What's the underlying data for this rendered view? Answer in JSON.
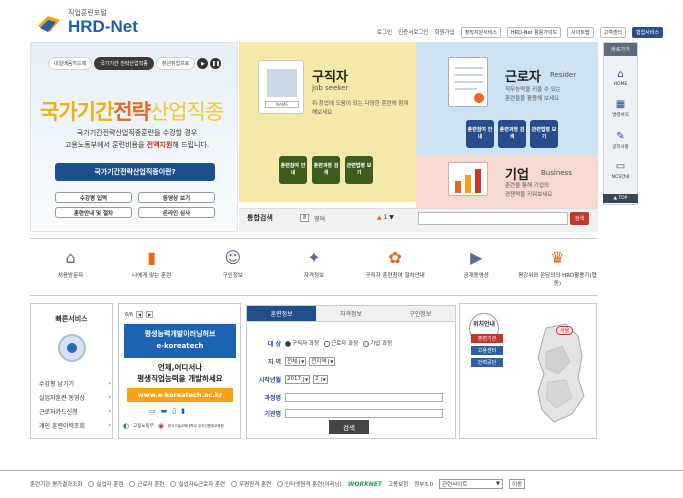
{
  "header": {
    "logo_sub": "직업훈련포털",
    "logo_main": "HRD-Net",
    "util_links": [
      "로그인",
      "인증서로그인",
      "회원가입"
    ],
    "util_buttons": [
      "정직지원서비스",
      "HRD-Net 활용가이드",
      "사이트맵",
      "고객센터"
    ],
    "util_service": "협업서비스"
  },
  "hero": {
    "tabs": [
      "내일배움카드제",
      "국가기간 전략산업직종",
      "청년취업프로"
    ],
    "title_a": "국가기간",
    "title_b": "전략",
    "title_c": "산업직종",
    "desc_line1": "국가기간전략산업직종훈련을 수강할 경우",
    "desc_line2a": "고용노동부에서 훈련비용을 ",
    "desc_line2b": "전액지원",
    "desc_line2c": "해 드립니다.",
    "main_button": "국가기간전략산업직종이란?",
    "buttons": [
      "수강평 입력",
      "동영상 보기",
      "훈련안내 및 절차",
      "온라인 심사"
    ]
  },
  "job_seeker": {
    "title": "구직자",
    "en": "Job seeker",
    "desc": "취·창업에 도움이 되는 다양한 훈련에 참여해보세요",
    "id_name": "NAME",
    "buttons": [
      "훈련참여 안내",
      "훈련과정 검색",
      "관련법령 보기"
    ]
  },
  "worker": {
    "title": "근로자",
    "en": "Resider",
    "desc_1": "직무능력을 키울 수 있는",
    "desc_2": "훈련들을 활용해 보세요",
    "buttons": [
      "훈련참여 안내",
      "훈련과정 검색",
      "관련법령 보기"
    ]
  },
  "business": {
    "title": "기업",
    "en": "Business",
    "desc_1": "훈련을 통해 기업의",
    "desc_2": "경쟁력을 키워보세요"
  },
  "search": {
    "label": "통합검색",
    "badge": "8",
    "lang": "영어",
    "count": "1",
    "go": "검색"
  },
  "sidebar": {
    "head": "바로가기",
    "items": [
      {
        "icon": "⌂",
        "label": "HOME"
      },
      {
        "icon": "▦",
        "label": "발령서식"
      },
      {
        "icon": "✎",
        "label": "공지사항"
      },
      {
        "icon": "▭",
        "label": "NCS안내"
      }
    ],
    "top": "▲ TOP"
  },
  "menu": [
    {
      "icon": "⌂",
      "label": "처음방문자",
      "orange": false
    },
    {
      "icon": "▮",
      "label": "나에게 맞는 훈련",
      "orange": true
    },
    {
      "icon": "☺",
      "label": "구인정보",
      "orange": false
    },
    {
      "icon": "✦",
      "label": "자격정보",
      "orange": false
    },
    {
      "icon": "✿",
      "label": "구직자 훈련참여 절차안내",
      "orange": true
    },
    {
      "icon": "▶",
      "label": "공개동영상",
      "orange": false
    },
    {
      "icon": "♛",
      "label": "평강위와 온담의의 HRD활용기(협동)",
      "orange": true
    }
  ],
  "quick": {
    "title": "빠른서비스",
    "items": [
      "수강평 남기기",
      "실업자훈련 동영상",
      "근로자카드신청",
      "개인 훈련이력조회"
    ],
    "arrow": "›"
  },
  "banner": {
    "page": "6/6",
    "prev": "◀",
    "next": "▶",
    "title_1": "평생능력개발이러닝허브",
    "title_2": "e-koreatech",
    "text_1": "언제,어디서나",
    "text_2": "평생직업능력을 개발하세요",
    "url": "www.e-koreatech.ac.kr",
    "logo_1": "고용노동부",
    "logo_2": "한국기술교육대학교 온라인평생교육원"
  },
  "form": {
    "tabs": [
      "훈련정보",
      "자격정보",
      "구인정보"
    ],
    "row_target": "대 상",
    "radio_1": "구직자 과정",
    "radio_2": "근로자 과정",
    "radio_3": "기업 과정",
    "row_region": "지 역",
    "region_1": "전체",
    "region_2": "전지역",
    "row_date": "시작년월",
    "year": "2017",
    "month": "2",
    "row_course": "과정명",
    "row_org": "기관명",
    "search": "검색"
  },
  "map": {
    "title": "위치안내",
    "btn_1": "훈련기관",
    "btn_2": "고용센터",
    "btn_3": "인력공단",
    "label": "서울"
  },
  "footer": {
    "lead": "훈련기관 평가결과조회",
    "items": [
      "실업자 훈련",
      "근로자 훈련",
      "실업자&근로자 훈련",
      "우편원격 훈련",
      "인터넷원격 훈련(이러닝)"
    ],
    "work": "WORKNET",
    "extra_1": "고용보험",
    "extra_2": "정부3.0",
    "select": "관련사이트",
    "go": "이동"
  }
}
